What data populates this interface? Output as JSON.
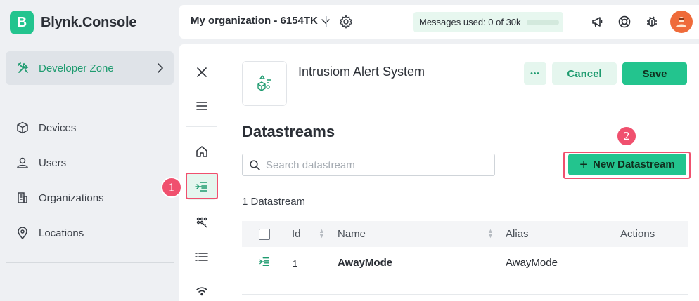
{
  "brand": {
    "badge": "B",
    "name": "Blynk.Console"
  },
  "sidebar": {
    "developer_zone": "Developer Zone",
    "items": [
      {
        "label": "Devices",
        "icon": "cube-icon"
      },
      {
        "label": "Users",
        "icon": "user-icon"
      },
      {
        "label": "Organizations",
        "icon": "building-icon"
      },
      {
        "label": "Locations",
        "icon": "pin-icon"
      }
    ]
  },
  "topbar": {
    "organization": "My organization - 6154TK",
    "messages_label": "Messages used: 0 of 30k",
    "messages_used_fraction": 0.0
  },
  "template": {
    "name": "Intrusiom Alert System"
  },
  "actions": {
    "more": "•••",
    "cancel": "Cancel",
    "save": "Save"
  },
  "datastreams": {
    "heading": "Datastreams",
    "search_placeholder": "Search datastream",
    "new_button": "New Datastream",
    "count_label": "1 Datastream",
    "columns": {
      "id": "Id",
      "name": "Name",
      "alias": "Alias",
      "actions": "Actions"
    },
    "rows": [
      {
        "id": "1",
        "name": "AwayMode",
        "alias": "AwayMode"
      }
    ]
  },
  "annotations": {
    "step1": "1",
    "step2": "2"
  },
  "colors": {
    "accent": "#23c48e",
    "accent_dark": "#1e9b6f",
    "highlight": "#f0506e"
  }
}
